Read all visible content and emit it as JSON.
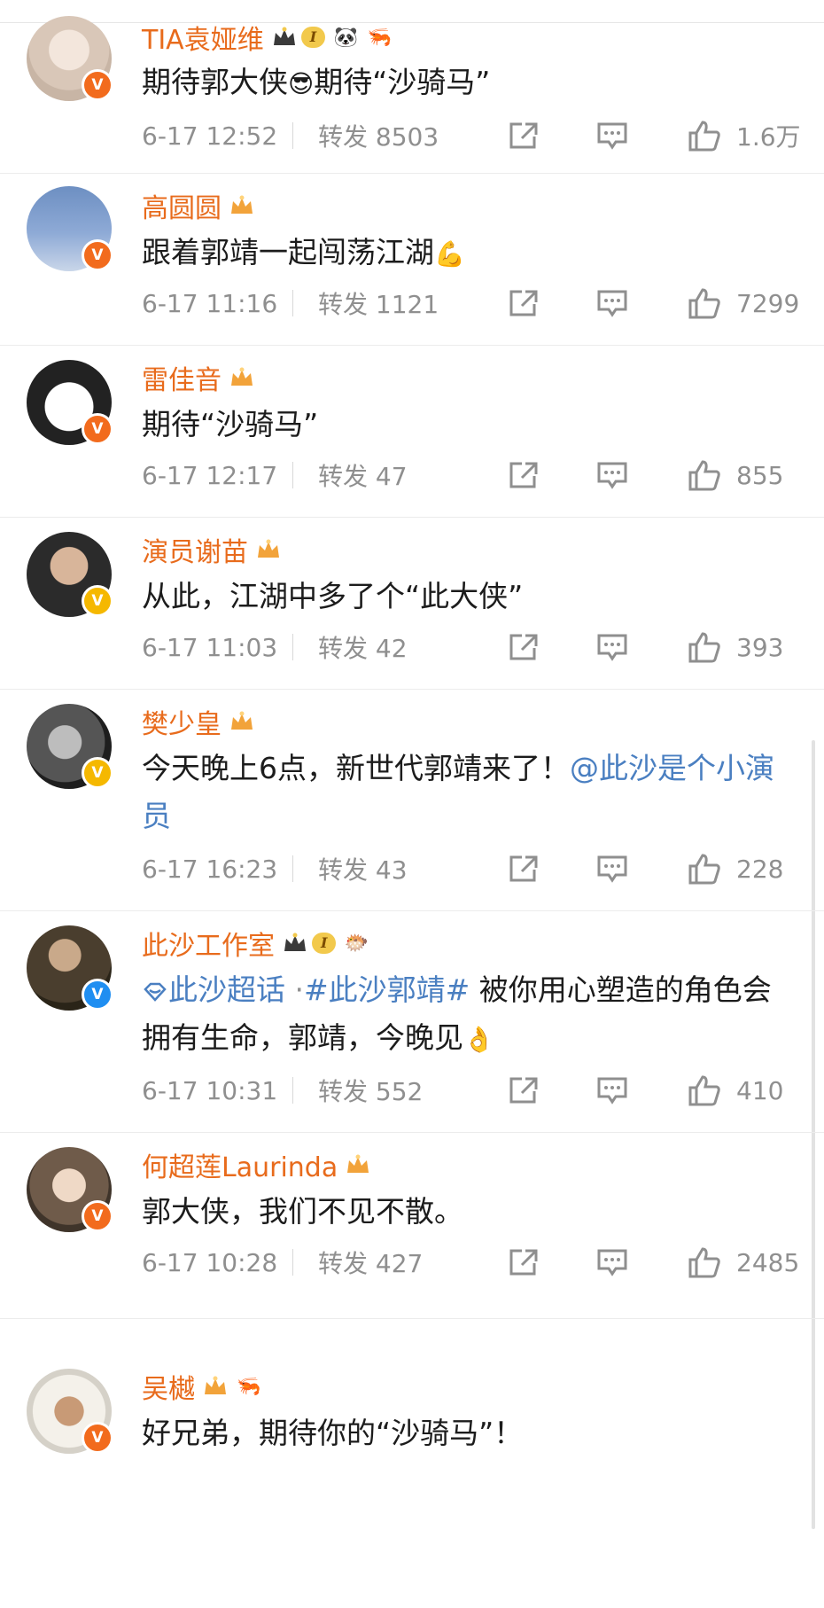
{
  "comments": [
    {
      "name": "TIA袁娅维",
      "text": "期待郭大侠",
      "text2": "期待“沙骑马”",
      "emoji": "😎",
      "date": "6-17 12:52",
      "forward": "转发 8503",
      "likes": "1.6万",
      "badge": "orange",
      "vip": "I",
      "extras": [
        "🐼",
        "🦐"
      ]
    },
    {
      "name": "高圆圆",
      "text": "跟着郭靖一起闯荡江湖",
      "emoji": "💪",
      "date": "6-17 11:16",
      "forward": "转发 1121",
      "likes": "7299",
      "badge": "orange"
    },
    {
      "name": "雷佳音",
      "text": "期待“沙骑马”",
      "date": "6-17 12:17",
      "forward": "转发 47",
      "likes": "855",
      "badge": "orange"
    },
    {
      "name": "演员谢苗",
      "text": "从此，江湖中多了个“此大侠”",
      "date": "6-17 11:03",
      "forward": "转发 42",
      "likes": "393",
      "badge": "yellow"
    },
    {
      "name": "樊少皇",
      "text": "今天晚上6点，新世代郭靖来了！",
      "link": "@此沙是个小演员",
      "date": "6-17 16:23",
      "forward": "转发 43",
      "likes": "228",
      "badge": "yellow"
    },
    {
      "name": "此沙工作室",
      "topic1": "此沙超话",
      "dot": " ·",
      "topic2": "#此沙郭靖#",
      "text": " 被你用心塑造的角色会拥有生命，郭靖，今晚见",
      "emoji": "👌",
      "date": "6-17 10:31",
      "forward": "转发 552",
      "likes": "410",
      "badge": "blue",
      "vip": "I",
      "extras": [
        "🐡"
      ]
    },
    {
      "name": "何超莲Laurinda",
      "text": "郭大侠，我们不见不散。",
      "date": "6-17 10:28",
      "forward": "转发 427",
      "likes": "2485",
      "badge": "orange"
    },
    {
      "name": "吴樾",
      "text": "好兄弟，期待你的“沙骑马”！",
      "badge": "orange",
      "extras": [
        "🦐"
      ]
    }
  ],
  "colors": {
    "name": "#e86b1c",
    "link": "#4a7fc1",
    "meta": "#8f8f8f"
  }
}
